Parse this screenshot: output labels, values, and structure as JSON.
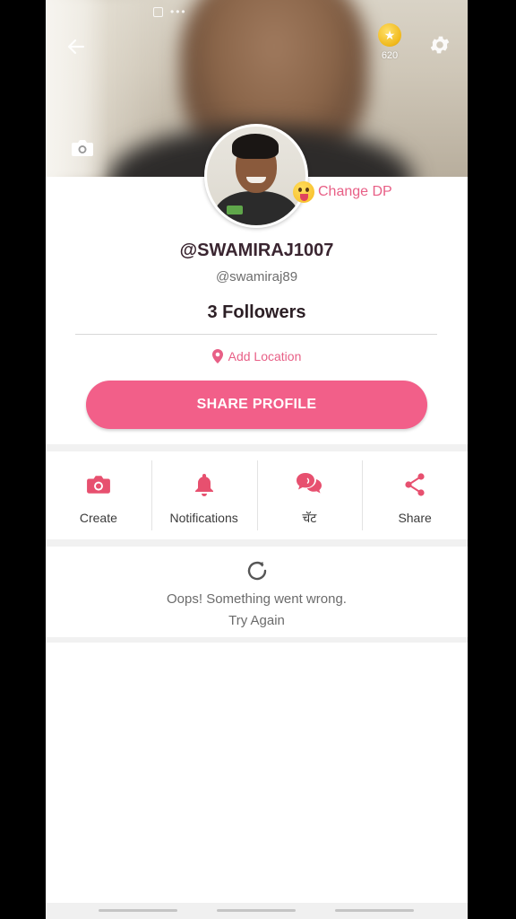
{
  "header": {
    "coins": "620",
    "change_dp_label": "Change DP"
  },
  "profile": {
    "username": "@SWAMIRAJ1007",
    "handle": "@swamiraj89",
    "followers": "3 Followers",
    "location_label": "Add Location",
    "share_button": "SHARE PROFILE"
  },
  "actions": [
    {
      "label": "Create",
      "icon": "camera-icon"
    },
    {
      "label": "Notifications",
      "icon": "bell-icon"
    },
    {
      "label": "चॅट",
      "icon": "chat-icon"
    },
    {
      "label": "Share",
      "icon": "share-icon"
    }
  ],
  "error": {
    "message": "Oops! Something went wrong.",
    "retry_label": "Try Again"
  },
  "colors": {
    "accent": "#f25f89",
    "accent_text": "#e85f86"
  }
}
